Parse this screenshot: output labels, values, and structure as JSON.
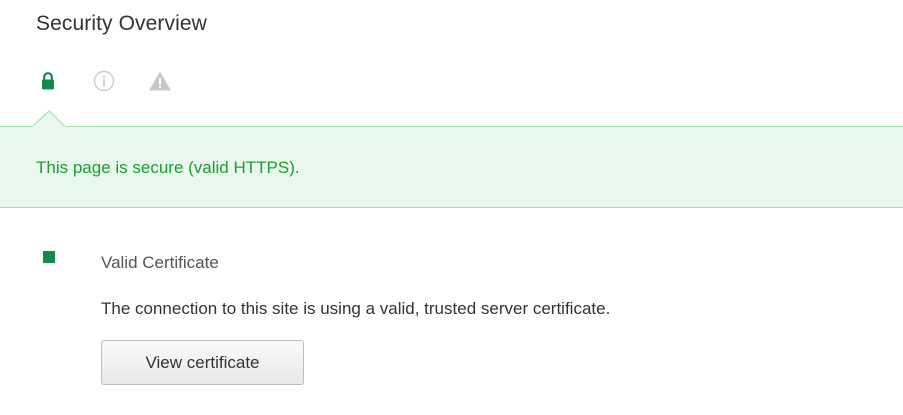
{
  "panel": {
    "title": "Security Overview"
  },
  "icons": [
    {
      "name": "lock-icon",
      "state": "active",
      "color": "#138a4c"
    },
    {
      "name": "info-icon",
      "state": "inactive",
      "color": "#cccccc"
    },
    {
      "name": "warning-icon",
      "state": "inactive",
      "color": "#c8c8c8"
    }
  ],
  "summary": {
    "text": "This page is secure (valid HTTPS).",
    "text_color": "#1a9f2f",
    "background": "#eaf7ec",
    "border_color": "#a9dfb0"
  },
  "certificate": {
    "status_color": "#138a4c",
    "title": "Valid Certificate",
    "description": "The connection to this site is using a valid, trusted server certificate.",
    "button_label": "View certificate"
  }
}
